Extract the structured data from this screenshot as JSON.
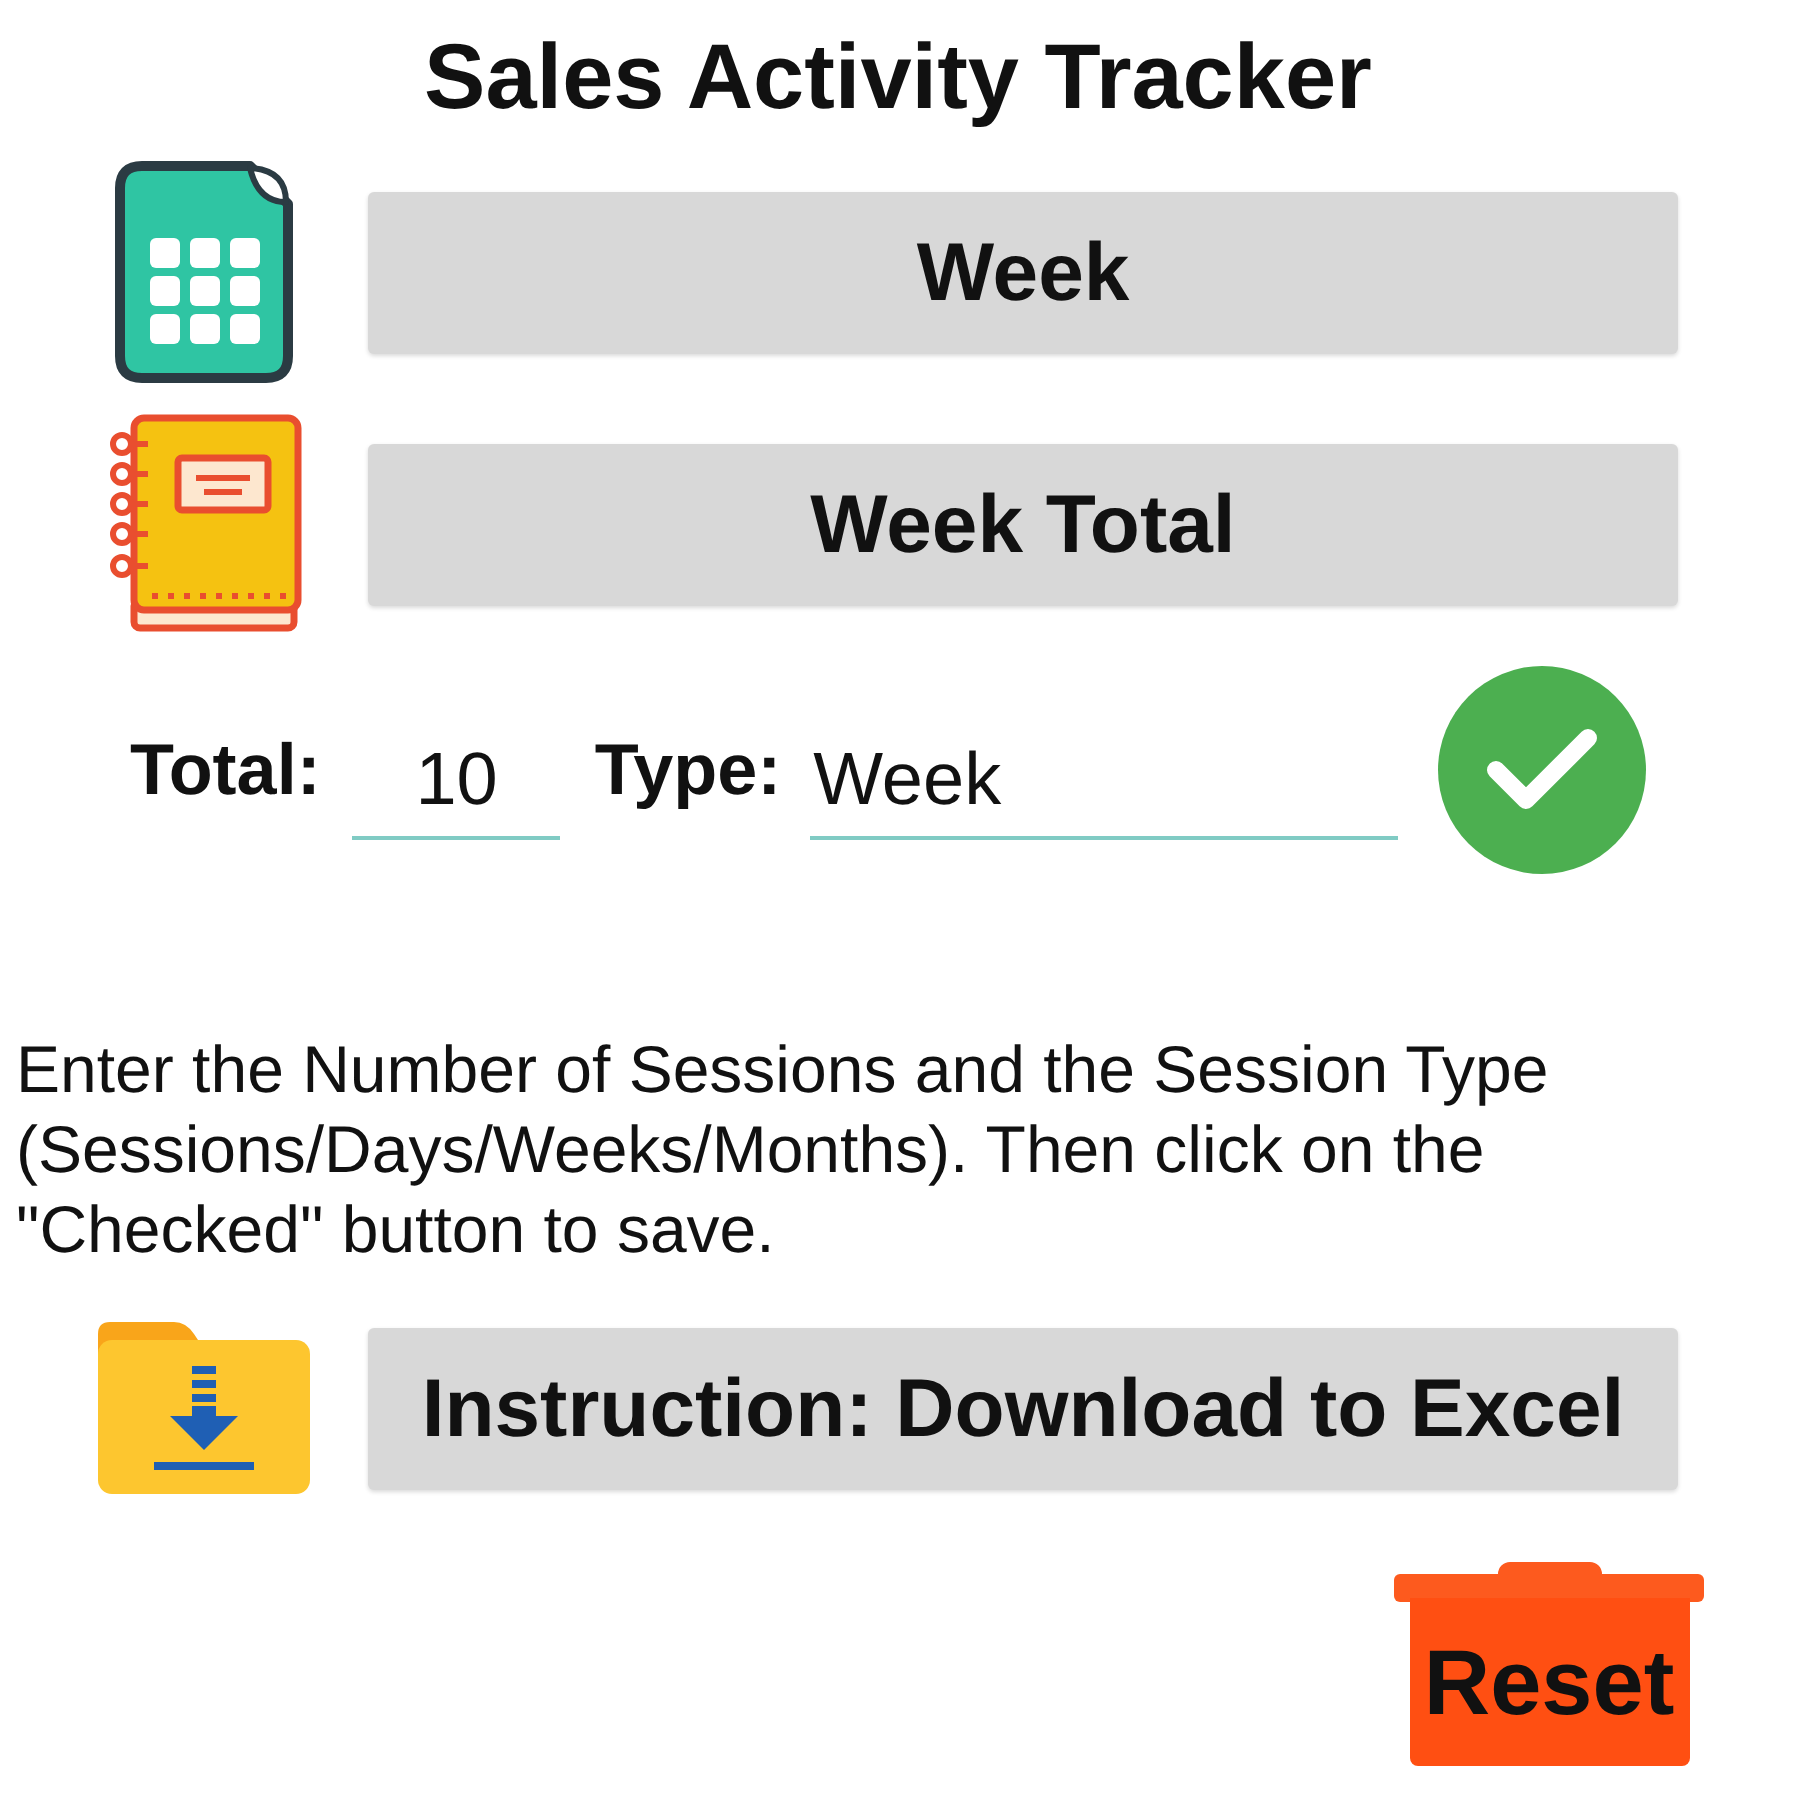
{
  "title": "Sales Activity Tracker",
  "actions": [
    {
      "kind": "calendar",
      "label": "Week"
    },
    {
      "kind": "notebook",
      "label": "Week Total"
    }
  ],
  "form": {
    "total_label": "Total:",
    "total_value": "10",
    "type_label": "Type:",
    "type_value": "Week"
  },
  "instructions": "Enter the Number of Sessions and the Session Type (Sessions/Days/Weeks/Months). Then click on the \"Checked\" button to save.",
  "download": {
    "kind": "folder",
    "label": "Instruction: Download to Excel"
  },
  "reset": {
    "label": "Reset"
  }
}
